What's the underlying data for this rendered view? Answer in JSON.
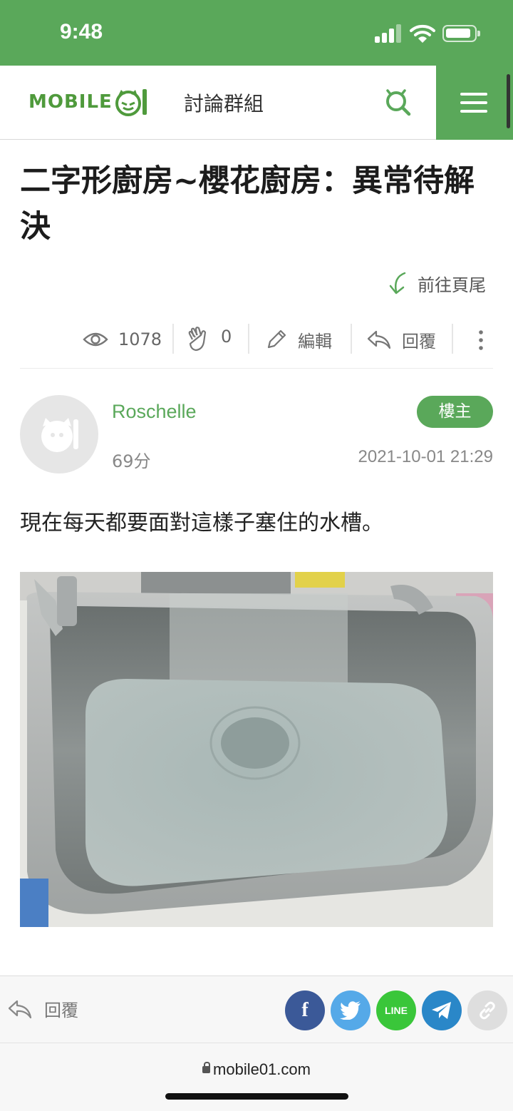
{
  "status_bar": {
    "time": "9:48"
  },
  "header": {
    "logo_text": "MOBILE",
    "section_title": "討論群組"
  },
  "post": {
    "title": "二字形廚房~櫻花廚房：異常待解決",
    "goto_bottom_label": "前往頁尾",
    "stats": {
      "views": "1078",
      "likes": "0",
      "edit_label": "編輯",
      "reply_label": "回覆"
    },
    "author": {
      "name": "Roschelle",
      "score": "69分",
      "badge": "樓主",
      "timestamp": "2021-10-01 21:29"
    },
    "body_text": "現在每天都要面對這樣子塞住的水槽。"
  },
  "share_bar": {
    "reply_label": "回覆",
    "facebook_glyph": "f",
    "line_label": "LINE"
  },
  "browser": {
    "url": "mobile01.com"
  },
  "colors": {
    "brand_green": "#5aa85a",
    "facebook": "#3b5998",
    "twitter": "#55a9e8",
    "line": "#3ac63a",
    "telegram": "#2a87c8"
  }
}
